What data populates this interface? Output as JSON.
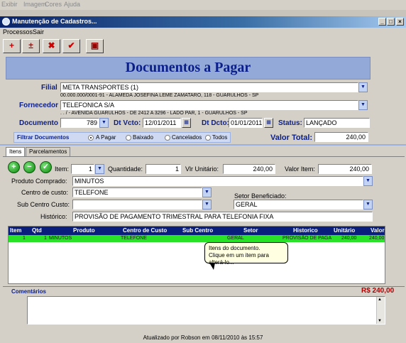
{
  "background_menu": [
    "Exibir",
    "Imagem",
    "Cores",
    "Ajuda"
  ],
  "window": {
    "title": "Manutenção de Cadastros...",
    "min": "_",
    "max": "□",
    "close": "×"
  },
  "menu": [
    "Processos",
    "Sair"
  ],
  "toolbar": [
    {
      "icon": "insert-record-icon",
      "glyph": "+"
    },
    {
      "icon": "edit-record-icon",
      "glyph": "±"
    },
    {
      "icon": "delete-icon",
      "glyph": "✖"
    },
    {
      "icon": "confirm-check-icon",
      "glyph": "✔"
    },
    {
      "icon": "calculator-icon",
      "glyph": "▣"
    }
  ],
  "header": {
    "title": "Documentos a Pagar"
  },
  "form": {
    "filial_label": "Filial",
    "filial_value": "META TRANSPORTES (1)",
    "filial_address": "00.000.000/0001-91 - ALAMEDA JOSEFINA LEME ZAMATARO, 118 - GUARULHOS - SP",
    "fornecedor_label": "Fornecedor",
    "fornecedor_value": "TELEFONICA S/A",
    "fornecedor_address": ". . / - AVENIDA GUARULHOS - DE 2412 A 3296 - LADO PAR, 1 - GUARULHOS - SP",
    "documento_label": "Documento",
    "documento_value": "789",
    "dtvcto_label": "Dt Vcto:",
    "dtvcto_value": "12/01/2011",
    "dtdcto_label": "Dt Dcto:",
    "dtdcto_value": "01/01/2011",
    "status_label": "Status:",
    "status_value": "LANÇADO",
    "filtrar_label": "Filtrar Documentos",
    "filters": [
      {
        "label": "A Pagar",
        "on": true
      },
      {
        "label": "Baixado",
        "on": false
      },
      {
        "label": "Cancelados",
        "on": false
      },
      {
        "label": "Todos",
        "on": false
      }
    ],
    "valor_total_label": "Valor Total:",
    "valor_total_value": "240,00"
  },
  "tabs": [
    "Itens",
    "Parcelamentos"
  ],
  "itens": {
    "add_glyph": "+",
    "remove_glyph": "−",
    "ok_glyph": "✓",
    "item_label": "Item:",
    "item_value": "1",
    "quantidade_label": "Quantidade:",
    "quantidade_value": "1",
    "vlr_unitario_label": "Vlr Unitário:",
    "vlr_unitario_value": "240,00",
    "valor_item_label": "Valor Item:",
    "valor_item_value": "240,00",
    "produto_label": "Produto Comprado:",
    "produto_value": "MINUTOS",
    "centro_label": "Centro de custo:",
    "centro_value": "TELEFONE",
    "sub_centro_label": "Sub Centro Custo:",
    "sub_centro_value": "",
    "setor_label": "Setor Beneficiado:",
    "setor_value": "GERAL",
    "historico_label": "Histórico:",
    "historico_value": "PROVISÃO DE PAGAMENTO TRIMESTRAL PARA TELEFONIA FIXA"
  },
  "grid": {
    "columns": [
      "Item",
      "Qtd",
      "Produto",
      "Centro de Custo",
      "Sub Centro",
      "Setor",
      "Historico",
      "Unitário",
      "Valor"
    ],
    "rows": [
      [
        "1",
        "1",
        "MINUTOS",
        "TELEFONE",
        "",
        "GERAL",
        "PROVISÃO DE PAGA",
        "240,00",
        "240,00"
      ]
    ]
  },
  "tooltip": {
    "line1": "Itens do documento.",
    "line2": "Clique em um item para alterá-lo..."
  },
  "comentarios_label": "Comentários",
  "comentarios_total": "R$ 240,00",
  "statusbar": "Atualizado por Robson em 08/11/2010 às 15:57",
  "colors": {
    "header_bg": "#93a9d8",
    "title": "#0b1f8a",
    "grid_head": "#0a1e7c",
    "grid_row": "#27e227",
    "total_red": "#b00000"
  }
}
